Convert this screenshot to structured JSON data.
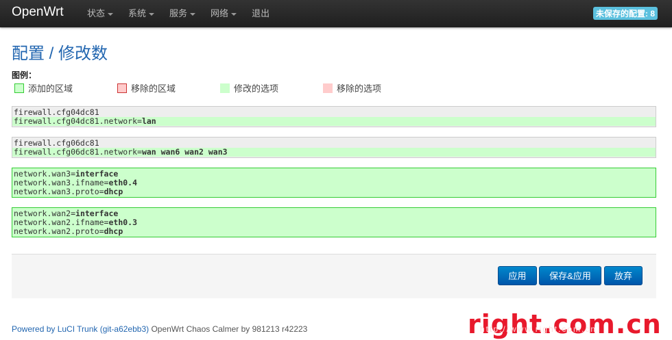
{
  "brand": "OpenWrt",
  "menu": [
    {
      "label": "状态",
      "caret": true
    },
    {
      "label": "系统",
      "caret": true
    },
    {
      "label": "服务",
      "caret": true
    },
    {
      "label": "网络",
      "caret": true
    },
    {
      "label": "退出",
      "caret": false
    }
  ],
  "unsaved_badge": "未保存的配置: 8",
  "page_title": "配置 / 修改数",
  "legend": {
    "title": "图例：",
    "items": [
      {
        "label": "添加的区域",
        "fill": "#ccffcc",
        "border": "#33cc33"
      },
      {
        "label": "移除的区域",
        "fill": "#ffcccc",
        "border": "#cc3333"
      },
      {
        "label": "修改的选项",
        "fill": "#ccffcc",
        "border": "#ccffcc"
      },
      {
        "label": "移除的选项",
        "fill": "#ffcccc",
        "border": "#ffcccc"
      }
    ]
  },
  "changes": [
    {
      "type": "modified",
      "lines": [
        {
          "key": "firewall.cfg04dc81",
          "value": "",
          "added": false
        },
        {
          "key": "firewall.cfg04dc81.network=",
          "value": "lan",
          "added": true
        }
      ]
    },
    {
      "type": "modified",
      "lines": [
        {
          "key": "firewall.cfg06dc81",
          "value": "",
          "added": false
        },
        {
          "key": "firewall.cfg06dc81.network=",
          "value": "wan wan6 wan2 wan3",
          "added": true
        }
      ]
    },
    {
      "type": "added",
      "lines": [
        {
          "key": "network.wan3=",
          "value": "interface",
          "added": false
        },
        {
          "key": "network.wan3.ifname=",
          "value": "eth0.4",
          "added": false
        },
        {
          "key": "network.wan3.proto=",
          "value": "dhcp",
          "added": false
        }
      ]
    },
    {
      "type": "added",
      "lines": [
        {
          "key": "network.wan2=",
          "value": "interface",
          "added": false
        },
        {
          "key": "network.wan2.ifname=",
          "value": "eth0.3",
          "added": false
        },
        {
          "key": "network.wan2.proto=",
          "value": "dhcp",
          "added": false
        }
      ]
    }
  ],
  "buttons": {
    "apply": "应用",
    "save_apply": "保存&应用",
    "revert": "放弃"
  },
  "footer": {
    "link_text": "Powered by LuCI Trunk (git-a62ebb3)",
    "text": " OpenWrt Chaos Calmer by 981213 r42223"
  },
  "watermark": "right.com.cn",
  "watermark_sub": "http://www.right.com.cn"
}
